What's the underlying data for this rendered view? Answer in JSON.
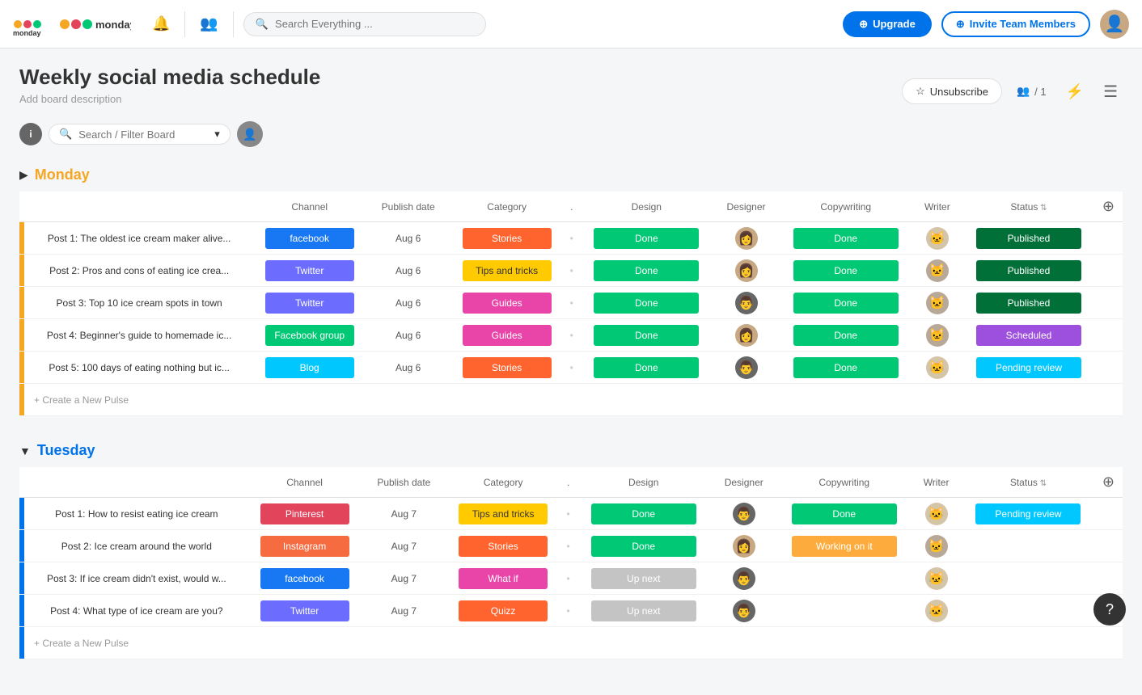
{
  "nav": {
    "logo_alt": "monday",
    "search_placeholder": "Search Everything ...",
    "upgrade_label": "Upgrade",
    "invite_label": "Invite Team Members"
  },
  "board": {
    "title": "Weekly social media schedule",
    "description": "Add board description",
    "unsubscribe_label": "Unsubscribe",
    "members_count": "/ 1"
  },
  "toolbar": {
    "search_placeholder": "Search / Filter Board"
  },
  "groups": [
    {
      "id": "monday",
      "label": "Monday",
      "color_class": "monday",
      "bar_class": "monday-bar",
      "columns": [
        "Channel",
        "Publish date",
        "Category",
        ".",
        "Design",
        "Designer",
        "Copywriting",
        "Writer",
        "Status"
      ],
      "rows": [
        {
          "title": "Post 1: The oldest ice cream maker alive...",
          "channel": "facebook",
          "channel_label": "facebook",
          "channel_class": "chip-facebook",
          "publish_date": "Aug 6",
          "category": "Stories",
          "category_class": "chip-stories",
          "design": "Done",
          "design_class": "status-done",
          "designer_type": "female",
          "copywriting": "Done",
          "copy_class": "status-done",
          "writer_type": "cat",
          "status": "Published",
          "status_class": "status-published"
        },
        {
          "title": "Post 2: Pros and cons of eating ice crea...",
          "channel": "Twitter",
          "channel_label": "Twitter",
          "channel_class": "chip-twitter",
          "publish_date": "Aug 6",
          "category": "Tips and tricks",
          "category_class": "chip-tips",
          "design": "Done",
          "design_class": "status-done",
          "designer_type": "female",
          "copywriting": "Done",
          "copy_class": "status-done",
          "writer_type": "cat2",
          "status": "Published",
          "status_class": "status-published"
        },
        {
          "title": "Post 3: Top 10 ice cream spots in town",
          "channel": "Twitter",
          "channel_label": "Twitter",
          "channel_class": "chip-twitter",
          "publish_date": "Aug 6",
          "category": "Guides",
          "category_class": "chip-guides",
          "design": "Done",
          "design_class": "status-done",
          "designer_type": "male",
          "copywriting": "Done",
          "copy_class": "status-done",
          "writer_type": "cat2",
          "status": "Published",
          "status_class": "status-published"
        },
        {
          "title": "Post 4: Beginner's guide to homemade ic...",
          "channel": "Facebook group",
          "channel_label": "Facebook group",
          "channel_class": "chip-facebook-group",
          "publish_date": "Aug 6",
          "category": "Guides",
          "category_class": "chip-guides",
          "design": "Done",
          "design_class": "status-done",
          "designer_type": "female",
          "copywriting": "Done",
          "copy_class": "status-done",
          "writer_type": "cat2",
          "status": "Scheduled",
          "status_class": "status-scheduled"
        },
        {
          "title": "Post 5: 100 days of eating nothing but ic...",
          "channel": "Blog",
          "channel_label": "Blog",
          "channel_class": "chip-blog",
          "publish_date": "Aug 6",
          "category": "Stories",
          "category_class": "chip-stories",
          "design": "Done",
          "design_class": "status-done",
          "designer_type": "male",
          "copywriting": "Done",
          "copy_class": "status-done",
          "writer_type": "cat",
          "status": "Pending review",
          "status_class": "status-pending"
        }
      ],
      "create_label": "+ Create a New Pulse"
    },
    {
      "id": "tuesday",
      "label": "Tuesday",
      "color_class": "tuesday",
      "bar_class": "tuesday-bar",
      "columns": [
        "Channel",
        "Publish date",
        "Category",
        ".",
        "Design",
        "Designer",
        "Copywriting",
        "Writer",
        "Status"
      ],
      "rows": [
        {
          "title": "Post 1: How to resist eating ice cream",
          "channel": "Pinterest",
          "channel_label": "Pinterest",
          "channel_class": "chip-pinterest",
          "publish_date": "Aug 7",
          "category": "Tips and tricks",
          "category_class": "chip-tips",
          "design": "Done",
          "design_class": "status-done",
          "designer_type": "male",
          "copywriting": "Done",
          "copy_class": "status-done",
          "writer_type": "cat",
          "status": "Pending review",
          "status_class": "status-pending"
        },
        {
          "title": "Post 2: Ice cream around the world",
          "channel": "Instagram",
          "channel_label": "Instagram",
          "channel_class": "chip-instagram",
          "publish_date": "Aug 7",
          "category": "Stories",
          "category_class": "chip-stories",
          "design": "Done",
          "design_class": "status-done",
          "designer_type": "female",
          "copywriting": "Working on it",
          "copy_class": "status-workon",
          "writer_type": "cat2",
          "status": "",
          "status_class": ""
        },
        {
          "title": "Post 3: If ice cream didn't exist, would w...",
          "channel": "facebook",
          "channel_label": "facebook",
          "channel_class": "chip-facebook",
          "publish_date": "Aug 7",
          "category": "What if",
          "category_class": "chip-whatif",
          "design": "Up next",
          "design_class": "status-upnext",
          "designer_type": "male",
          "copywriting": "",
          "copy_class": "",
          "writer_type": "cat",
          "status": "",
          "status_class": ""
        },
        {
          "title": "Post 4: What type of ice cream are you?",
          "channel": "Twitter",
          "channel_label": "Twitter",
          "channel_class": "chip-twitter",
          "publish_date": "Aug 7",
          "category": "Quizz",
          "category_class": "chip-quizz",
          "design": "Up next",
          "design_class": "status-upnext",
          "designer_type": "male",
          "copywriting": "",
          "copy_class": "",
          "writer_type": "cat",
          "status": "",
          "status_class": ""
        }
      ],
      "create_label": "+ Create a New Pulse"
    }
  ]
}
